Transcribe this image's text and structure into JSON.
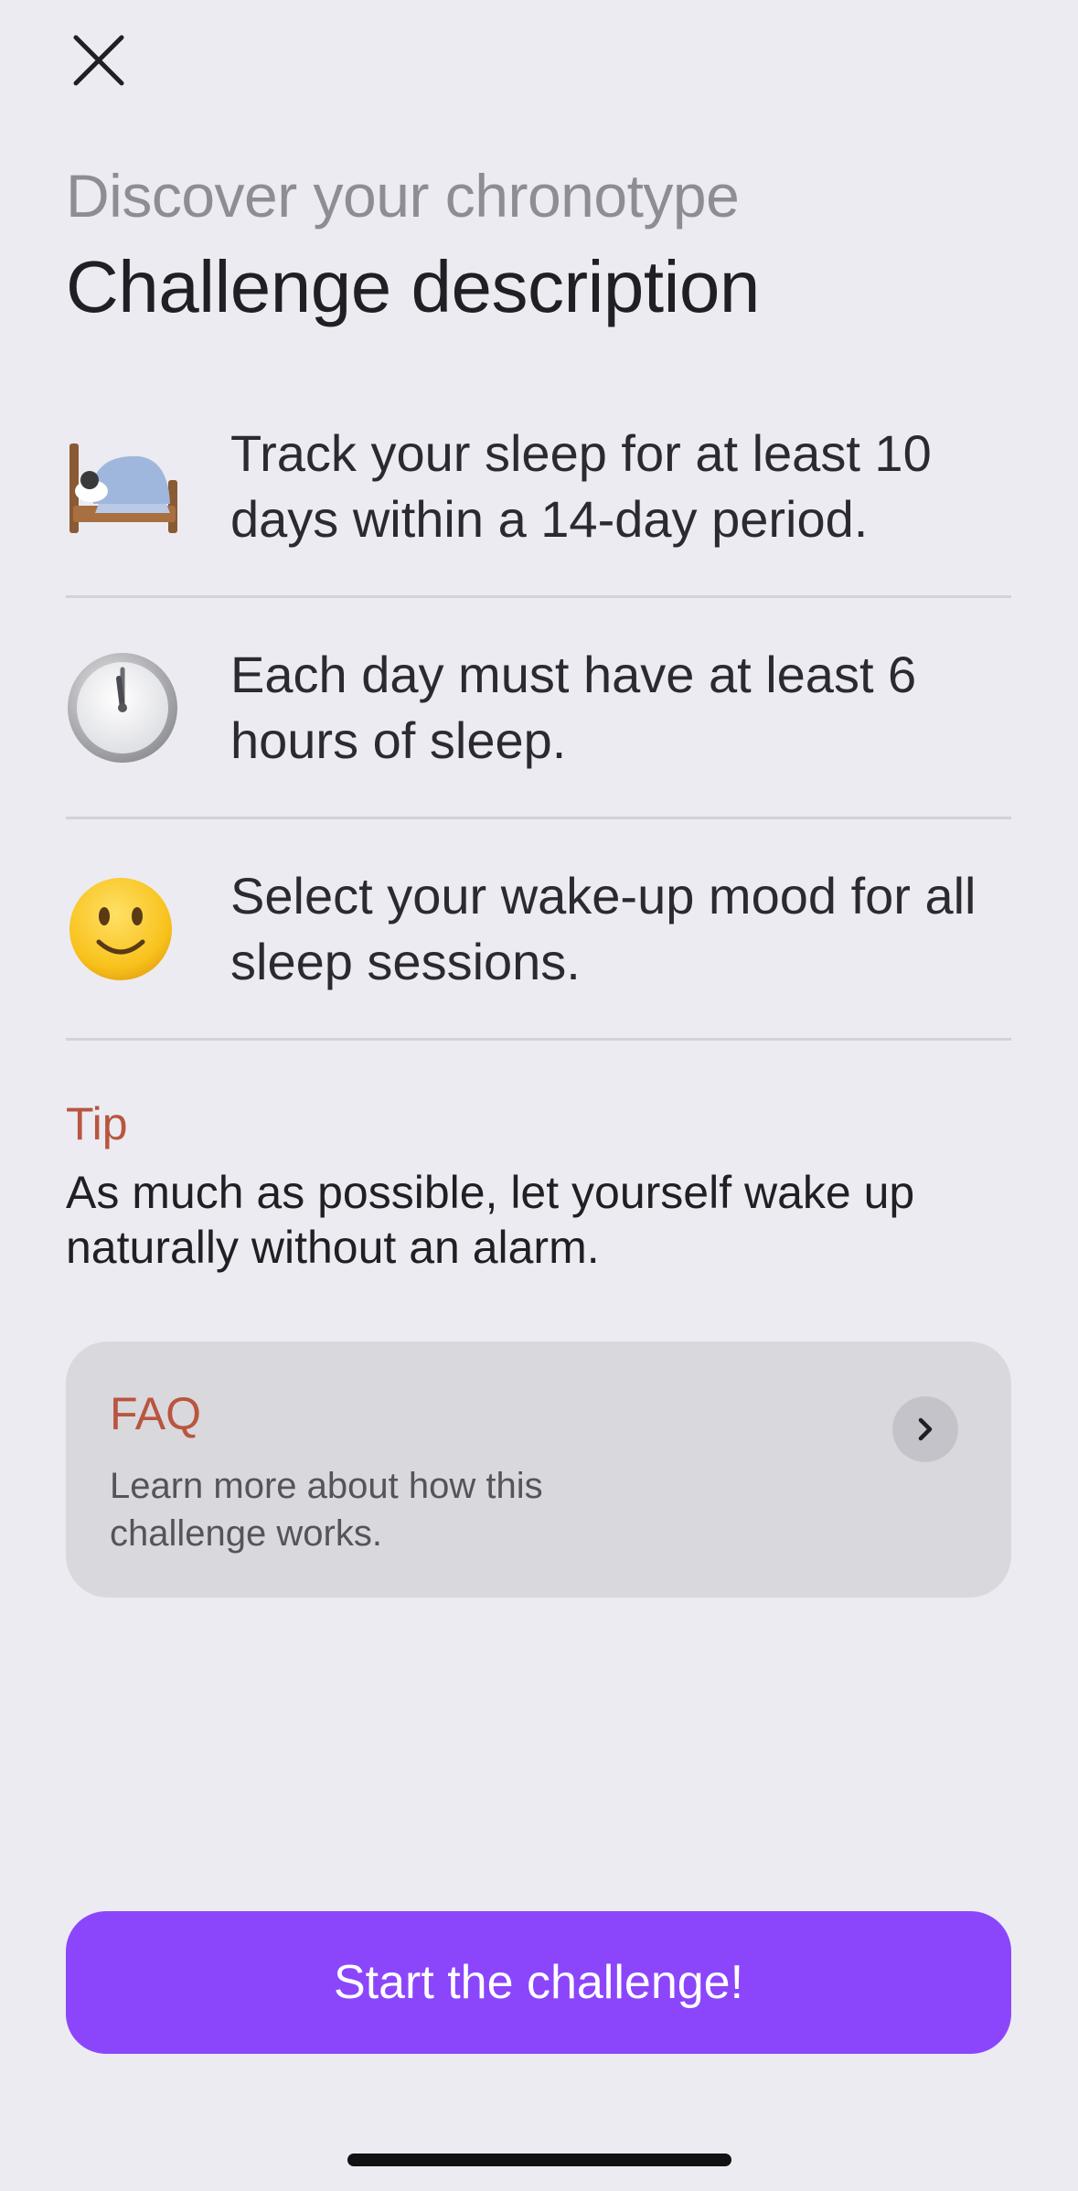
{
  "header": {
    "close_icon": "close-icon",
    "subtitle": "Discover your chronotype",
    "title": "Challenge description"
  },
  "rules": [
    {
      "icon": "bed-icon",
      "text": "Track your sleep for at least 10 days within a 14-day period."
    },
    {
      "icon": "clock-icon",
      "text": "Each day must have at least 6 hours of sleep."
    },
    {
      "icon": "smiling-face-icon",
      "text": "Select your wake-up mood for all sleep sessions."
    }
  ],
  "tip": {
    "label": "Tip",
    "text": "As much as possible, let yourself wake up naturally without an alarm."
  },
  "faq": {
    "title": "FAQ",
    "description": "Learn more about how this challenge works.",
    "chevron_icon": "chevron-right-icon"
  },
  "cta": {
    "label": "Start the challenge!"
  },
  "colors": {
    "background": "#ecebf1",
    "accent": "#8b46fc",
    "tip_accent": "#b9553f",
    "card": "#d9d8dd"
  }
}
